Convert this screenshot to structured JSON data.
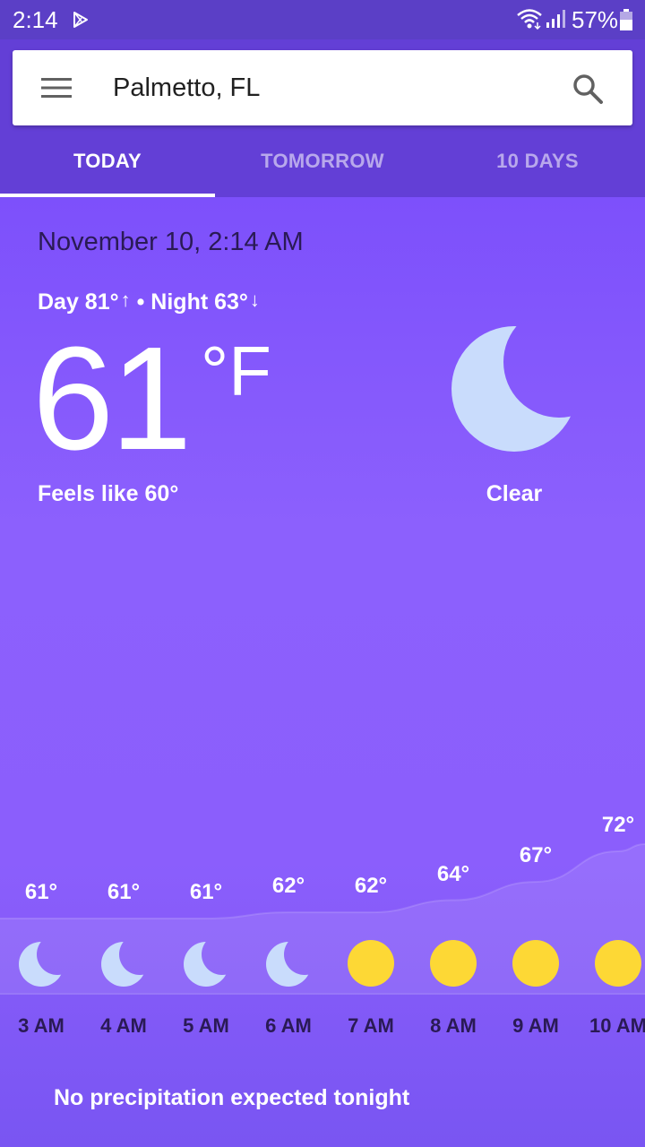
{
  "status_bar": {
    "time": "2:14",
    "battery": "57%",
    "icons": [
      "play-store-icon",
      "wifi-icon",
      "signal-icon",
      "battery-icon"
    ]
  },
  "search": {
    "location": "Palmetto, FL",
    "icons": [
      "menu-icon",
      "search-icon"
    ]
  },
  "tabs": [
    {
      "label": "TODAY",
      "selected": true
    },
    {
      "label": "TOMORROW",
      "selected": false
    },
    {
      "label": "10 DAYS",
      "selected": false
    }
  ],
  "current": {
    "date": "November 10, 2:14 AM",
    "day_label": "Day 81°",
    "night_label": "Night 63°",
    "separator": "•",
    "up_arrow": "↑",
    "down_arrow": "↓",
    "temperature": "61",
    "unit": "°F",
    "feels_like": "Feels like 60°",
    "condition": "Clear",
    "condition_icon": "moon-icon"
  },
  "hourly": [
    {
      "time": "3 AM",
      "temp_label": "61°",
      "temp": 61,
      "icon": "moon-icon"
    },
    {
      "time": "4 AM",
      "temp_label": "61°",
      "temp": 61,
      "icon": "moon-icon"
    },
    {
      "time": "5 AM",
      "temp_label": "61°",
      "temp": 61,
      "icon": "moon-icon"
    },
    {
      "time": "6 AM",
      "temp_label": "62°",
      "temp": 62,
      "icon": "moon-icon"
    },
    {
      "time": "7 AM",
      "temp_label": "62°",
      "temp": 62,
      "icon": "sun-icon"
    },
    {
      "time": "8 AM",
      "temp_label": "64°",
      "temp": 64,
      "icon": "sun-icon"
    },
    {
      "time": "9 AM",
      "temp_label": "67°",
      "temp": 67,
      "icon": "sun-icon"
    },
    {
      "time": "10 AM",
      "temp_label": "72°",
      "temp": 72,
      "icon": "sun-icon"
    }
  ],
  "precipitation": "No precipitation expected tonight",
  "colors": {
    "header": "#633fd6",
    "status_bar": "#5b3fc6",
    "moon": "#c9dcfc",
    "sun": "#fdd835"
  }
}
